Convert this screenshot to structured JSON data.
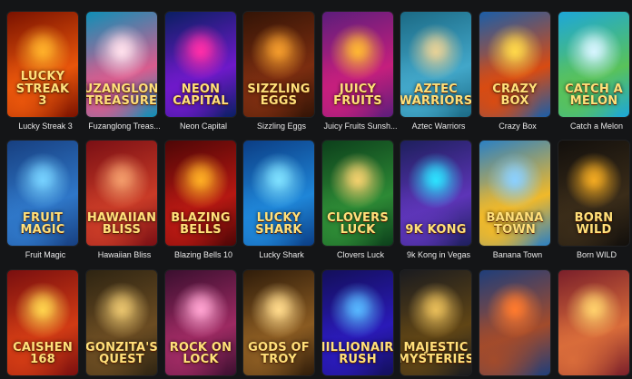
{
  "games": [
    {
      "title": "Lucky Streak 3",
      "logo": "Lucky Streak 3",
      "colors": [
        "#7a1200",
        "#e8550b",
        "#ffb02a"
      ]
    },
    {
      "title": "Fuzanglong Treas...",
      "logo": "Fuzanglong Treasure",
      "colors": [
        "#0f8fb6",
        "#d95c8e",
        "#ffe0ec"
      ]
    },
    {
      "title": "Neon Capital",
      "logo": "Neon Capital",
      "colors": [
        "#0a1f63",
        "#6e19c9",
        "#ff2ea8"
      ]
    },
    {
      "title": "Sizzling Eggs",
      "logo": "Sizzling Eggs",
      "colors": [
        "#331406",
        "#7b2d10",
        "#f39b2c"
      ]
    },
    {
      "title": "Juicy Fruits Sunsh...",
      "logo": "Juicy Fruits",
      "colors": [
        "#5c1d7b",
        "#c51f7d",
        "#ffb733"
      ]
    },
    {
      "title": "Aztec Warriors",
      "logo": "Aztec Warriors",
      "colors": [
        "#1b6a85",
        "#42a7c9",
        "#e6d197"
      ]
    },
    {
      "title": "Crazy Box",
      "logo": "Crazy Box",
      "colors": [
        "#1b5ea8",
        "#d84b12",
        "#ffd84a"
      ]
    },
    {
      "title": "Catch a Melon",
      "logo": "Catch a Melon",
      "colors": [
        "#1da7d8",
        "#59c25a",
        "#d6f5ff"
      ]
    },
    {
      "title": "Fruit Magic",
      "logo": "Fruit Magic",
      "colors": [
        "#173f80",
        "#2f77c8",
        "#76d1ff"
      ]
    },
    {
      "title": "Hawaiian Bliss",
      "logo": "Hawaiian Bliss",
      "colors": [
        "#7a0f14",
        "#c93b27",
        "#f39b6a"
      ]
    },
    {
      "title": "Blazing Bells 10",
      "logo": "Blazing Bells",
      "colors": [
        "#4e0606",
        "#b51812",
        "#ffae24"
      ]
    },
    {
      "title": "Lucky Shark",
      "logo": "Lucky Shark",
      "colors": [
        "#0b3d84",
        "#1f86d8",
        "#7ee0ff"
      ]
    },
    {
      "title": "Clovers Luck",
      "logo": "Clovers Luck",
      "colors": [
        "#0c3f1b",
        "#2d8a35",
        "#f2d06d"
      ]
    },
    {
      "title": "9k Kong in Vegas",
      "logo": "9k Kong",
      "colors": [
        "#1d1f5c",
        "#5d35b8",
        "#2de2ff"
      ]
    },
    {
      "title": "Banana Town",
      "logo": "Banana Town",
      "colors": [
        "#2b80c4",
        "#f0b92a",
        "#8bd0ff"
      ]
    },
    {
      "title": "Born WILD",
      "logo": "Born Wild",
      "colors": [
        "#120f0c",
        "#3a2c19",
        "#f2aa22"
      ]
    },
    {
      "title": "",
      "logo": "Caishen 168",
      "colors": [
        "#7a0f0f",
        "#d13b14",
        "#ffd34d"
      ]
    },
    {
      "title": "",
      "logo": "Gonzita's Quest",
      "colors": [
        "#2e2412",
        "#6b4c22",
        "#e8c36d"
      ]
    },
    {
      "title": "",
      "logo": "Rock on Lock",
      "colors": [
        "#3b0f2f",
        "#9d2a62",
        "#ffa2d0"
      ]
    },
    {
      "title": "",
      "logo": "Gods of Troy",
      "colors": [
        "#2f1c0a",
        "#8a5b22",
        "#ffd98a"
      ]
    },
    {
      "title": "",
      "logo": "Millionaire Rush",
      "colors": [
        "#130f5a",
        "#2a1ab8",
        "#57b7ff"
      ]
    },
    {
      "title": "",
      "logo": "Majestic Mysteries",
      "colors": [
        "#1a1b1f",
        "#604515",
        "#e7bc58"
      ]
    },
    {
      "title": "",
      "logo": "",
      "colors": [
        "#1f3e7a",
        "#a34b2b",
        "#ff7a2e"
      ]
    },
    {
      "title": "",
      "logo": "",
      "colors": [
        "#7a1f2a",
        "#d96c3a",
        "#ffcf6b"
      ]
    }
  ]
}
